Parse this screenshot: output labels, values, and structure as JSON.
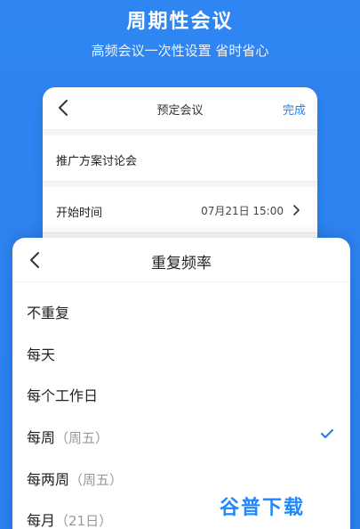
{
  "hero": {
    "title": "周期性会议",
    "subtitle": "高频会议一次性设置 省时省心"
  },
  "back_card": {
    "nav_title": "预定会议",
    "done_label": "完成",
    "meeting_name": "推广方案讨论会",
    "start_label": "开始时间",
    "start_value": "07月21日 15:00"
  },
  "sheet": {
    "title": "重复频率",
    "options": [
      {
        "label": "不重复",
        "sub": ""
      },
      {
        "label": "每天",
        "sub": ""
      },
      {
        "label": "每个工作日",
        "sub": ""
      },
      {
        "label": "每周",
        "sub": "（周五）",
        "selected": true
      },
      {
        "label": "每两周",
        "sub": "（周五）"
      },
      {
        "label": "每月",
        "sub": "（21日）"
      }
    ]
  },
  "watermark": "谷普下载",
  "colors": {
    "accent": "#2b7df0",
    "background": "#2f86f2"
  }
}
